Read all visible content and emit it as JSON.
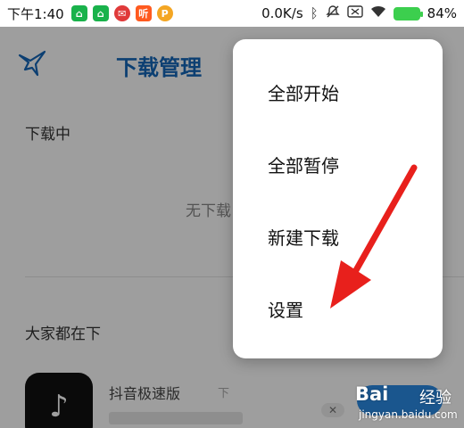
{
  "status_bar": {
    "time": "下午1:40",
    "network_speed": "0.0K/s",
    "battery": "84%",
    "colors": {
      "battery": "#3ccf4e"
    },
    "icons": [
      "app-icon-green",
      "app-icon-green",
      "app-icon-red",
      "app-icon-ting",
      "app-icon-p",
      "bluetooth-icon",
      "mute-icon",
      "sim-icon",
      "wifi-icon",
      "battery-icon"
    ],
    "app_glyphs": [
      "⌂",
      "⌂",
      "✉",
      "听",
      "P"
    ]
  },
  "header": {
    "title": "下载管理",
    "back_icon": "bird-back-icon",
    "title_color": "#1466b8"
  },
  "sections": {
    "downloading_label": "下载中",
    "empty_text": "无下载",
    "popular_label": "大家都在下"
  },
  "recommended_app": {
    "name": "抖音极速版",
    "tag": "下"
  },
  "menu": {
    "items": [
      {
        "label": "全部开始"
      },
      {
        "label": "全部暂停"
      },
      {
        "label": "新建下载"
      },
      {
        "label": "设置"
      }
    ]
  },
  "watermark": {
    "brand": "Bai",
    "text": "经验",
    "url": "jingyan.baidu.com"
  },
  "annotation": {
    "arrow_color": "#e8201c"
  }
}
